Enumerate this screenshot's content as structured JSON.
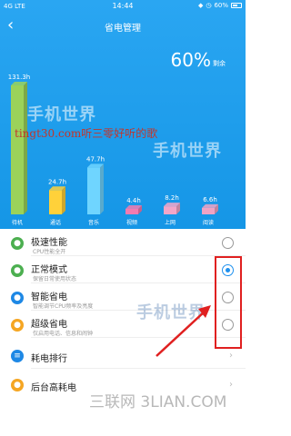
{
  "status": {
    "network": "4G LTE",
    "time": "14:44",
    "battery": "60%"
  },
  "header": {
    "title": "省电管理",
    "remaining_value": "60%",
    "remaining_label": "剩余"
  },
  "chart_data": {
    "type": "bar",
    "categories": [
      "待机",
      "通话",
      "音乐",
      "视频",
      "上网",
      "阅读"
    ],
    "values": [
      131.3,
      24.7,
      47.7,
      4.4,
      8.2,
      6.6
    ],
    "data_labels": [
      "131.3h",
      "24.7h",
      "47.7h",
      "4.4h",
      "8.2h",
      "6.6h"
    ],
    "colors": [
      "#9bd25a",
      "#ffd13a",
      "#6fd5ff",
      "#f27bb0",
      "#f3a6c8",
      "#f0a3c4"
    ]
  },
  "watermarks": {
    "overlay_text": "tingt30.com听三零好听的歌",
    "logo": "手机世界",
    "logo_small": "手机世界",
    "footer": "三联网 3LIAN.COM"
  },
  "modes": [
    {
      "title": "极速性能",
      "subtitle": "CPU性能全开",
      "selected": false,
      "icon_color": "#4caf50",
      "icon": "dot"
    },
    {
      "title": "正常模式",
      "subtitle": "保留日常使用状态",
      "selected": true,
      "icon_color": "#4caf50",
      "icon": "dot"
    },
    {
      "title": "智能省电",
      "subtitle": "智能调节CPU频率及亮度",
      "selected": false,
      "icon_color": "#1e88e5",
      "icon": "dot"
    },
    {
      "title": "超级省电",
      "subtitle": "仅启用电话、信息和闹钟",
      "selected": false,
      "icon_color": "#f5a623",
      "icon": "dot"
    }
  ],
  "links": [
    {
      "title": "耗电排行",
      "icon_color": "#1e88e5"
    },
    {
      "title": "后台高耗电",
      "icon_color": "#f5a623"
    }
  ],
  "accent": "#1e90ee",
  "annotation_color": "#e02020"
}
